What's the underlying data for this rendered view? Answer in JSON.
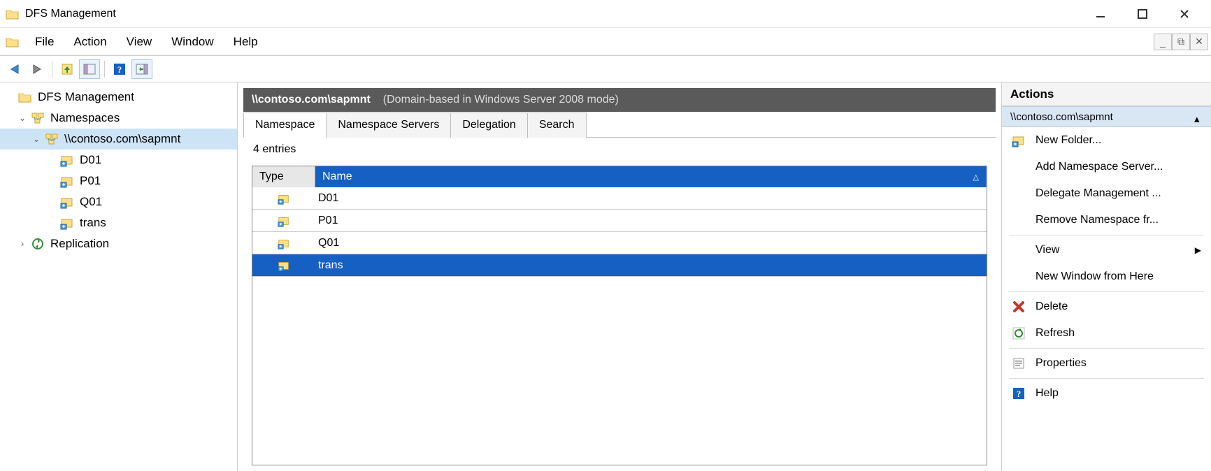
{
  "window": {
    "title": "DFS Management"
  },
  "menu": {
    "items": [
      "File",
      "Action",
      "View",
      "Window",
      "Help"
    ]
  },
  "tree": {
    "root": "DFS Management",
    "namespaces_label": "Namespaces",
    "namespace_path": "\\\\contoso.com\\sapmnt",
    "folders": [
      "D01",
      "P01",
      "Q01",
      "trans"
    ],
    "replication_label": "Replication"
  },
  "content": {
    "path": "\\\\contoso.com\\sapmnt",
    "mode": "(Domain-based in Windows Server 2008 mode)",
    "tabs": [
      "Namespace",
      "Namespace Servers",
      "Delegation",
      "Search"
    ],
    "entries_count_label": "4 entries",
    "columns": {
      "type": "Type",
      "name": "Name"
    },
    "rows": [
      {
        "name": "D01",
        "selected": false
      },
      {
        "name": "P01",
        "selected": false
      },
      {
        "name": "Q01",
        "selected": false
      },
      {
        "name": "trans",
        "selected": true
      }
    ]
  },
  "actions": {
    "header": "Actions",
    "context": "\\\\contoso.com\\sapmnt",
    "items": [
      {
        "label": "New Folder...",
        "icon": "new-folder"
      },
      {
        "label": "Add Namespace Server...",
        "icon": "blank"
      },
      {
        "label": "Delegate Management ...",
        "icon": "blank"
      },
      {
        "label": "Remove Namespace fr...",
        "icon": "blank"
      },
      {
        "sep": true
      },
      {
        "label": "View",
        "icon": "blank",
        "submenu": true
      },
      {
        "label": "New Window from Here",
        "icon": "blank"
      },
      {
        "sep": true
      },
      {
        "label": "Delete",
        "icon": "delete"
      },
      {
        "label": "Refresh",
        "icon": "refresh"
      },
      {
        "sep": true
      },
      {
        "label": "Properties",
        "icon": "properties"
      },
      {
        "sep": true
      },
      {
        "label": "Help",
        "icon": "help"
      }
    ]
  }
}
